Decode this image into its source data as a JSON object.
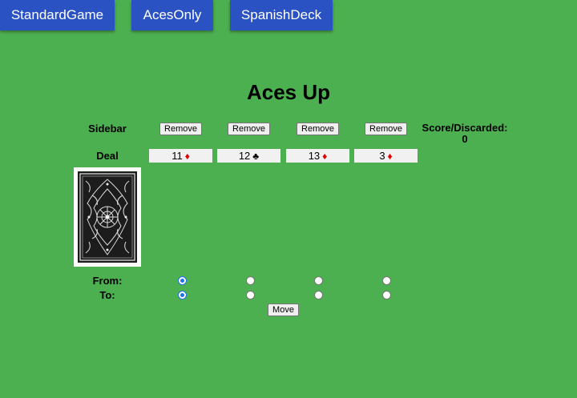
{
  "nav": {
    "standard_label": "StandardGame",
    "aces_label": "AcesOnly",
    "spanish_label": "SpanishDeck"
  },
  "title": "Aces Up",
  "sidebar_label": "Sidebar",
  "deal_label": "Deal",
  "remove_label": "Remove",
  "score": {
    "label": "Score/Discarded:",
    "value": "0"
  },
  "columns": [
    {
      "rank": "11",
      "suit": "♦",
      "suit_color": "#e00000"
    },
    {
      "rank": "12",
      "suit": "♣",
      "suit_color": "#000000"
    },
    {
      "rank": "13",
      "suit": "♦",
      "suit_color": "#e00000"
    },
    {
      "rank": "3",
      "suit": "♦",
      "suit_color": "#e00000"
    }
  ],
  "from_label": "From:",
  "to_label": "To:",
  "from_selected": 0,
  "to_selected": 0,
  "move_label": "Move",
  "colors": {
    "background": "#4caf50",
    "nav_button": "#2b52c2"
  }
}
